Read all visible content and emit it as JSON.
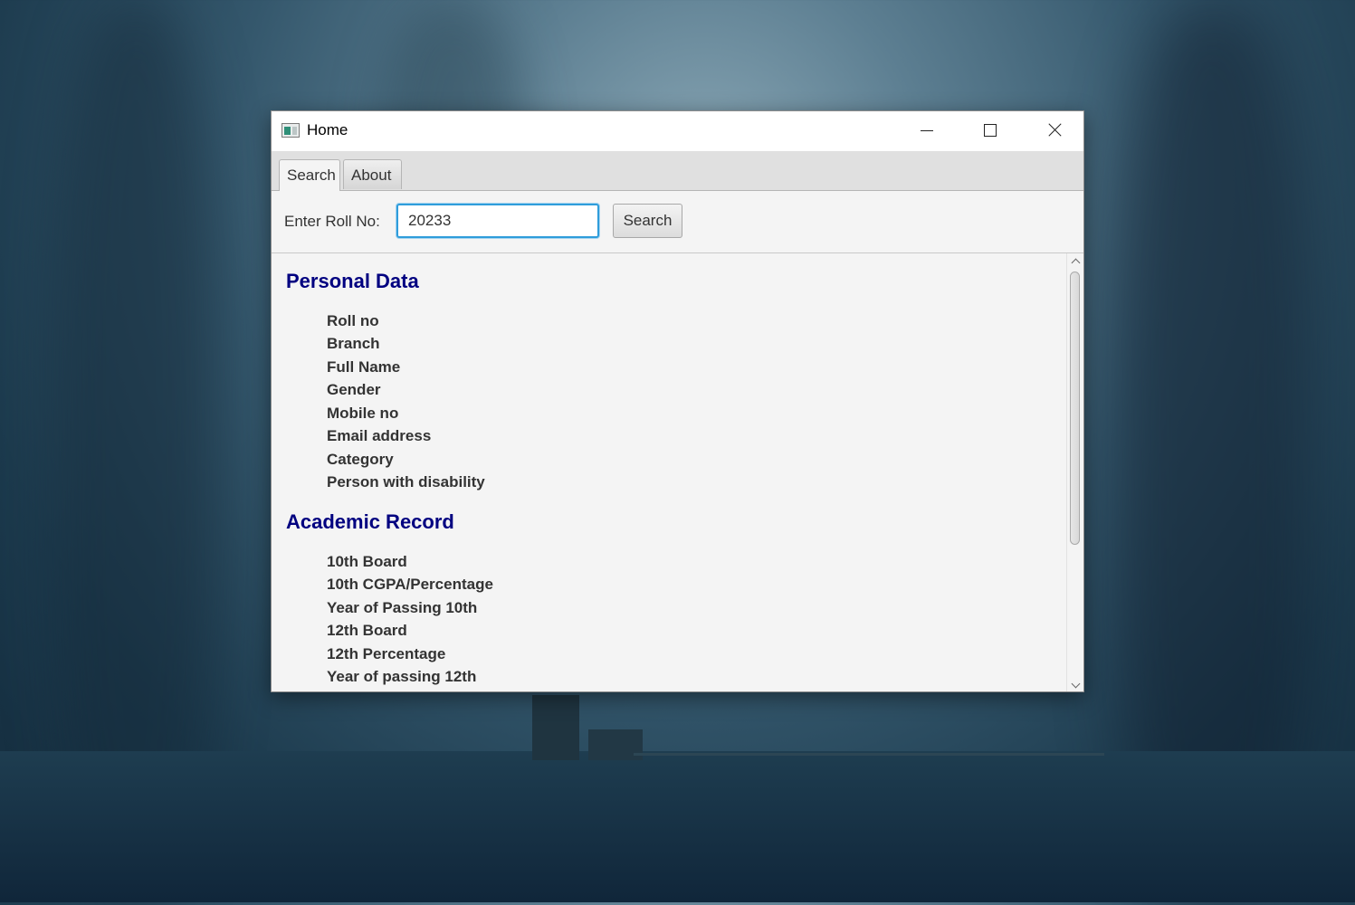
{
  "window": {
    "title": "Home"
  },
  "tabs": [
    {
      "label": "Search",
      "selected": true
    },
    {
      "label": "About",
      "selected": false
    }
  ],
  "search": {
    "label": "Enter Roll No:",
    "value": "20233",
    "button_label": "Search"
  },
  "sections": {
    "personal": {
      "title": "Personal Data",
      "fields": [
        "Roll no",
        "Branch",
        "Full Name",
        "Gender",
        "Mobile no",
        "Email address",
        "Category",
        "Person with disability"
      ]
    },
    "academic": {
      "title": "Academic Record",
      "fields": [
        "10th Board",
        "10th CGPA/Percentage",
        "Year of Passing 10th",
        "12th Board",
        "12th Percentage",
        "Year of passing 12th"
      ]
    }
  },
  "colors": {
    "section_title": "#000080",
    "focus_border": "#2f9ddb",
    "panel_bg": "#f4f4f4"
  }
}
